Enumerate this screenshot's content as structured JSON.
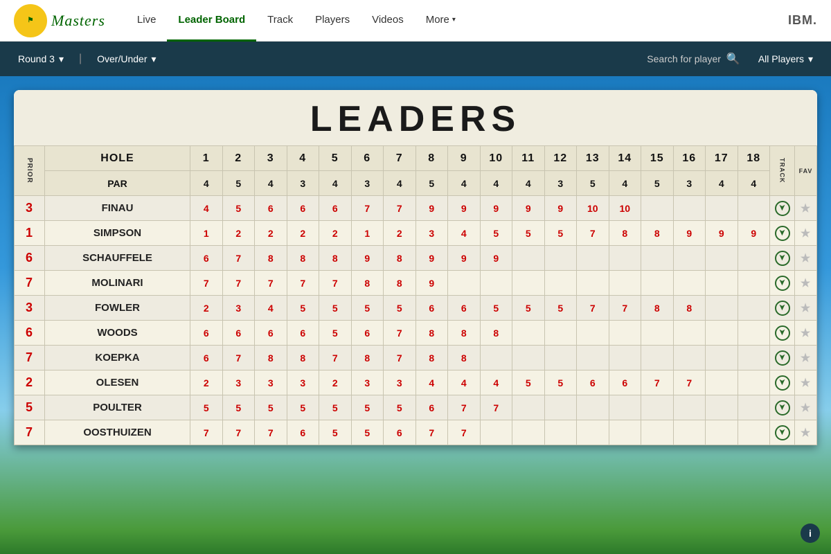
{
  "nav": {
    "logo_text": "Masters",
    "ibm_label": "IBM.",
    "links": [
      {
        "label": "Live",
        "active": false
      },
      {
        "label": "Leader Board",
        "active": true
      },
      {
        "label": "Track",
        "active": false
      },
      {
        "label": "Players",
        "active": false
      },
      {
        "label": "Videos",
        "active": false
      },
      {
        "label": "More",
        "active": false,
        "has_arrow": true
      }
    ]
  },
  "sub_nav": {
    "round_label": "Round 3",
    "over_under_label": "Over/Under",
    "search_placeholder": "Search for player",
    "all_players_label": "All Players"
  },
  "board": {
    "title": "LEADERS",
    "headers": {
      "prior": "PRIOR",
      "hole": "HOLE",
      "par": "PAR",
      "track": "TRACK",
      "fav": "FAV",
      "holes": [
        1,
        2,
        3,
        4,
        5,
        6,
        7,
        8,
        9,
        10,
        11,
        12,
        13,
        14,
        15,
        16,
        17,
        18
      ]
    },
    "par_values": [
      4,
      5,
      4,
      3,
      4,
      3,
      4,
      5,
      4,
      4,
      4,
      3,
      5,
      4,
      5,
      3,
      4,
      4
    ],
    "players": [
      {
        "prior": "3",
        "name": "FINAU",
        "scores": [
          "4",
          "5",
          "6",
          "6",
          "6",
          "7",
          "7",
          "9",
          "9",
          "9",
          "9",
          "9",
          "10",
          "10",
          "",
          "",
          "",
          ""
        ]
      },
      {
        "prior": "1",
        "name": "SIMPSON",
        "scores": [
          "1",
          "2",
          "2",
          "2",
          "2",
          "1",
          "2",
          "3",
          "4",
          "5",
          "5",
          "5",
          "7",
          "8",
          "8",
          "9",
          "9",
          "9"
        ]
      },
      {
        "prior": "6",
        "name": "SCHAUFFELE",
        "scores": [
          "6",
          "7",
          "8",
          "8",
          "8",
          "9",
          "8",
          "9",
          "9",
          "9",
          "",
          "",
          "",
          "",
          "",
          "",
          "",
          ""
        ]
      },
      {
        "prior": "7",
        "name": "MOLINARI",
        "scores": [
          "7",
          "7",
          "7",
          "7",
          "7",
          "8",
          "8",
          "9",
          "",
          "",
          "",
          "",
          "",
          "",
          "",
          "",
          "",
          ""
        ]
      },
      {
        "prior": "3",
        "name": "FOWLER",
        "scores": [
          "2",
          "3",
          "4",
          "5",
          "5",
          "5",
          "5",
          "6",
          "6",
          "5",
          "5",
          "5",
          "7",
          "7",
          "8",
          "8",
          "",
          ""
        ]
      },
      {
        "prior": "6",
        "name": "WOODS",
        "scores": [
          "6",
          "6",
          "6",
          "6",
          "5",
          "6",
          "7",
          "8",
          "8",
          "8",
          "",
          "",
          "",
          "",
          "",
          "",
          "",
          ""
        ]
      },
      {
        "prior": "7",
        "name": "KOEPKA",
        "scores": [
          "6",
          "7",
          "8",
          "8",
          "7",
          "8",
          "7",
          "8",
          "8",
          "",
          "",
          "",
          "",
          "",
          "",
          "",
          "",
          ""
        ]
      },
      {
        "prior": "2",
        "name": "OLESEN",
        "scores": [
          "2",
          "3",
          "3",
          "3",
          "2",
          "3",
          "3",
          "4",
          "4",
          "4",
          "5",
          "5",
          "6",
          "6",
          "7",
          "7",
          "",
          ""
        ]
      },
      {
        "prior": "5",
        "name": "POULTER",
        "scores": [
          "5",
          "5",
          "5",
          "5",
          "5",
          "5",
          "5",
          "6",
          "7",
          "7",
          "",
          "",
          "",
          "",
          "",
          "",
          "",
          ""
        ]
      },
      {
        "prior": "7",
        "name": "OOSTHUIZEN",
        "scores": [
          "7",
          "7",
          "7",
          "6",
          "5",
          "5",
          "6",
          "7",
          "7",
          "",
          "",
          "",
          "",
          "",
          "",
          "",
          "",
          ""
        ]
      }
    ]
  }
}
